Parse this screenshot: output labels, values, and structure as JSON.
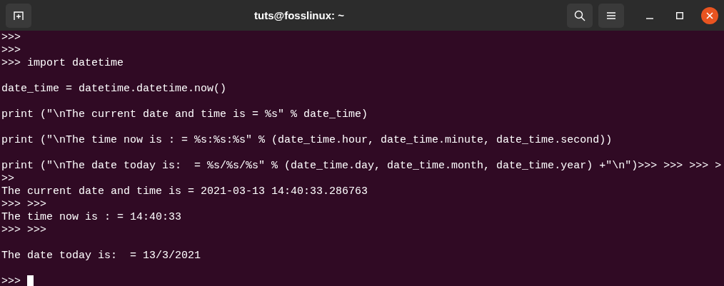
{
  "window": {
    "title": "tuts@fosslinux: ~"
  },
  "terminal": {
    "lines": [
      {
        "kind": "text",
        "text": ">>>"
      },
      {
        "kind": "text",
        "text": ">>>"
      },
      {
        "kind": "text",
        "text": ">>> import datetime"
      },
      {
        "kind": "blank"
      },
      {
        "kind": "text",
        "text": "date_time = datetime.datetime.now()"
      },
      {
        "kind": "blank"
      },
      {
        "kind": "text",
        "text": "print (\"\\nThe current date and time is = %s\" % date_time)"
      },
      {
        "kind": "blank"
      },
      {
        "kind": "text",
        "text": "print (\"\\nThe time now is : = %s:%s:%s\" % (date_time.hour, date_time.minute, date_time.second))"
      },
      {
        "kind": "blank"
      },
      {
        "kind": "text",
        "text": "print (\"\\nThe date today is:  = %s/%s/%s\" % (date_time.day, date_time.month, date_time.year) +\"\\n\")>>> >>> >>> >"
      },
      {
        "kind": "text",
        "text": ">>"
      },
      {
        "kind": "text",
        "text": "The current date and time is = 2021-03-13 14:40:33.286763"
      },
      {
        "kind": "text",
        "text": ">>> >>>"
      },
      {
        "kind": "text",
        "text": "The time now is : = 14:40:33"
      },
      {
        "kind": "text",
        "text": ">>> >>>"
      },
      {
        "kind": "blank"
      },
      {
        "kind": "text",
        "text": "The date today is:  = 13/3/2021"
      },
      {
        "kind": "blank"
      },
      {
        "kind": "cursor",
        "text": ">>> "
      }
    ]
  }
}
